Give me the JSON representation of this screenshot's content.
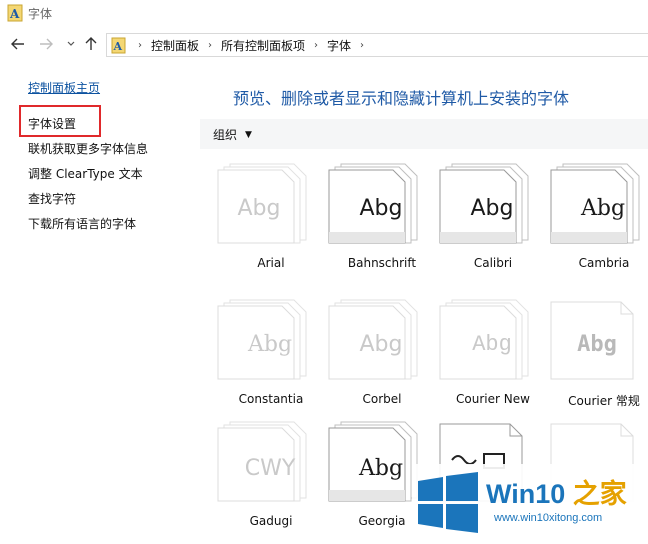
{
  "window": {
    "title": "字体",
    "icon": "fonts-folder-icon"
  },
  "nav": {
    "back": "back-arrow-icon",
    "forward": "forward-arrow-icon",
    "recent": "chevron-down-icon",
    "up": "up-arrow-icon",
    "breadcrumbs": [
      "控制面板",
      "所有控制面板项",
      "字体"
    ]
  },
  "sidebar": {
    "home_link": "控制面板主页",
    "items": [
      "字体设置",
      "联机获取更多字体信息",
      "调整 ClearType 文本",
      "查找字符",
      "下载所有语言的字体"
    ]
  },
  "main": {
    "heading": "预览、删除或者显示和隐藏计算机上安装的字体",
    "toolbar": {
      "organize": "组织"
    },
    "fonts": [
      {
        "name": "Arial",
        "sample": "Abg"
      },
      {
        "name": "Bahnschrift",
        "sample": "Abg"
      },
      {
        "name": "Calibri",
        "sample": "Abg"
      },
      {
        "name": "Cambria",
        "sample": "Abg"
      },
      {
        "name": "Constantia",
        "sample": "Abg"
      },
      {
        "name": "Corbel",
        "sample": "Abg"
      },
      {
        "name": "Courier New",
        "sample": "Abg"
      },
      {
        "name": "Courier 常规",
        "sample": "Abg"
      },
      {
        "name": "Gadugi",
        "sample": "CWY"
      },
      {
        "name": "Georgia",
        "sample": "Abg"
      }
    ]
  },
  "watermark": {
    "title_prefix": "Win10",
    "title_suffix": " 之家",
    "url": "www.win10xitong.com"
  },
  "colors": {
    "link": "#0c52a0",
    "heading": "#1f5aa6",
    "highlight": "#e0292b",
    "brand": "#1b75bb"
  }
}
